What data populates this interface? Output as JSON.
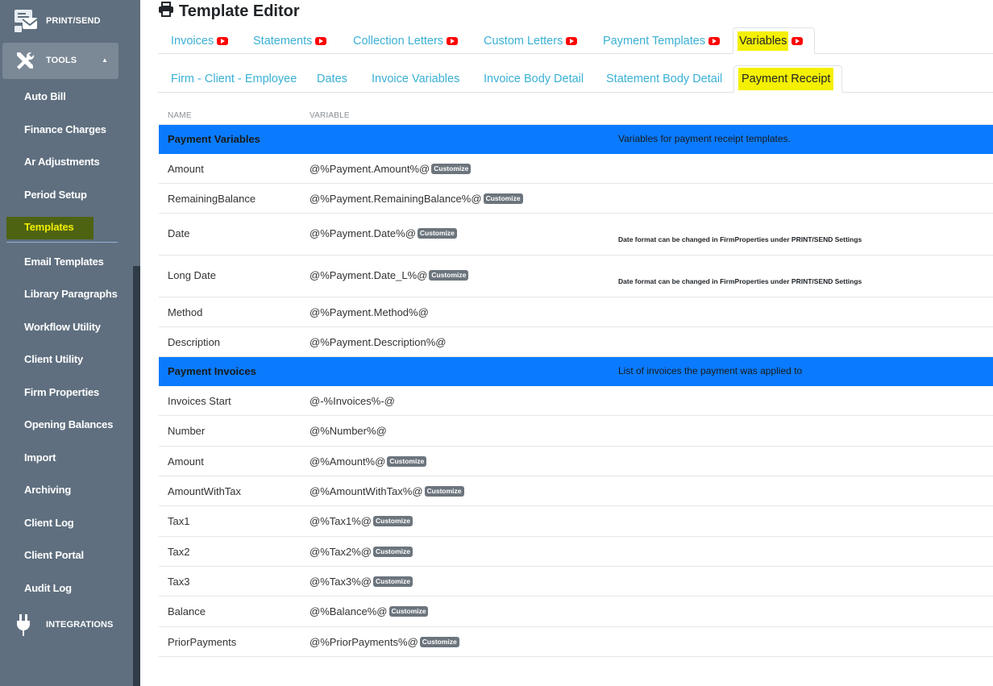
{
  "sidebar": {
    "print_send": "PRINT/SEND",
    "tools": "TOOLS",
    "integrations": "INTEGRATIONS",
    "items": [
      {
        "label": "Auto Bill"
      },
      {
        "label": "Finance Charges"
      },
      {
        "label": "Ar Adjustments"
      },
      {
        "label": "Period Setup"
      },
      {
        "label": "Templates"
      },
      {
        "label": "Email Templates"
      },
      {
        "label": "Library Paragraphs"
      },
      {
        "label": "Workflow Utility"
      },
      {
        "label": "Client Utility"
      },
      {
        "label": "Firm Properties"
      },
      {
        "label": "Opening Balances"
      },
      {
        "label": "Import"
      },
      {
        "label": "Archiving"
      },
      {
        "label": "Client Log"
      },
      {
        "label": "Client Portal"
      },
      {
        "label": "Audit Log"
      }
    ],
    "active_item": "Templates"
  },
  "page": {
    "title": "Template Editor"
  },
  "tabs": [
    {
      "label": "Invoices"
    },
    {
      "label": "Statements"
    },
    {
      "label": "Collection Letters"
    },
    {
      "label": "Custom Letters"
    },
    {
      "label": "Payment Templates"
    },
    {
      "label": "Variables"
    }
  ],
  "subtabs": [
    {
      "label": "Firm - Client - Employee"
    },
    {
      "label": "Dates"
    },
    {
      "label": "Invoice Variables"
    },
    {
      "label": "Invoice Body Detail"
    },
    {
      "label": "Statement Body Detail"
    },
    {
      "label": "Payment Receipt"
    }
  ],
  "table": {
    "col_name": "NAME",
    "col_variable": "VARIABLE",
    "customize_label": "Customize",
    "rows": [
      {
        "type": "header",
        "name": "Payment Variables",
        "desc": "Variables for payment receipt templates."
      },
      {
        "name": "Amount",
        "variable": "@%Payment.Amount%@"
      },
      {
        "name": "RemainingBalance",
        "variable": "@%Payment.RemainingBalance%@"
      },
      {
        "name": "Date",
        "variable": "@%Payment.Date%@",
        "note": "Date format can be changed in FirmProperties under PRINT/SEND Settings"
      },
      {
        "name": "Long Date",
        "variable": "@%Payment.Date_L%@",
        "note": "Date format can be changed in FirmProperties under PRINT/SEND Settings"
      },
      {
        "name": "Method",
        "variable": "@%Payment.Method%@"
      },
      {
        "name": "Description",
        "variable": "@%Payment.Description%@"
      },
      {
        "type": "header",
        "name": "Payment Invoices",
        "desc": "List of invoices the payment was applied to"
      },
      {
        "name": "Invoices Start",
        "variable": "@-%Invoices%-@"
      },
      {
        "name": "Number",
        "variable": "@%Number%@"
      },
      {
        "name": "Amount",
        "variable": "@%Amount%@"
      },
      {
        "name": "AmountWithTax",
        "variable": "@%AmountWithTax%@"
      },
      {
        "name": "Tax1",
        "variable": "@%Tax1%@"
      },
      {
        "name": "Tax2",
        "variable": "@%Tax2%@"
      },
      {
        "name": "Tax3",
        "variable": "@%Tax3%@"
      },
      {
        "name": "Balance",
        "variable": "@%Balance%@"
      },
      {
        "name": "PriorPayments",
        "variable": "@%PriorPayments%@"
      }
    ]
  },
  "colors": {
    "sidebar_bg": "#5f6f7f",
    "header_row_bg": "#0a7bff",
    "tab_link": "#3ab0d6",
    "highlight": "#f4f000"
  }
}
